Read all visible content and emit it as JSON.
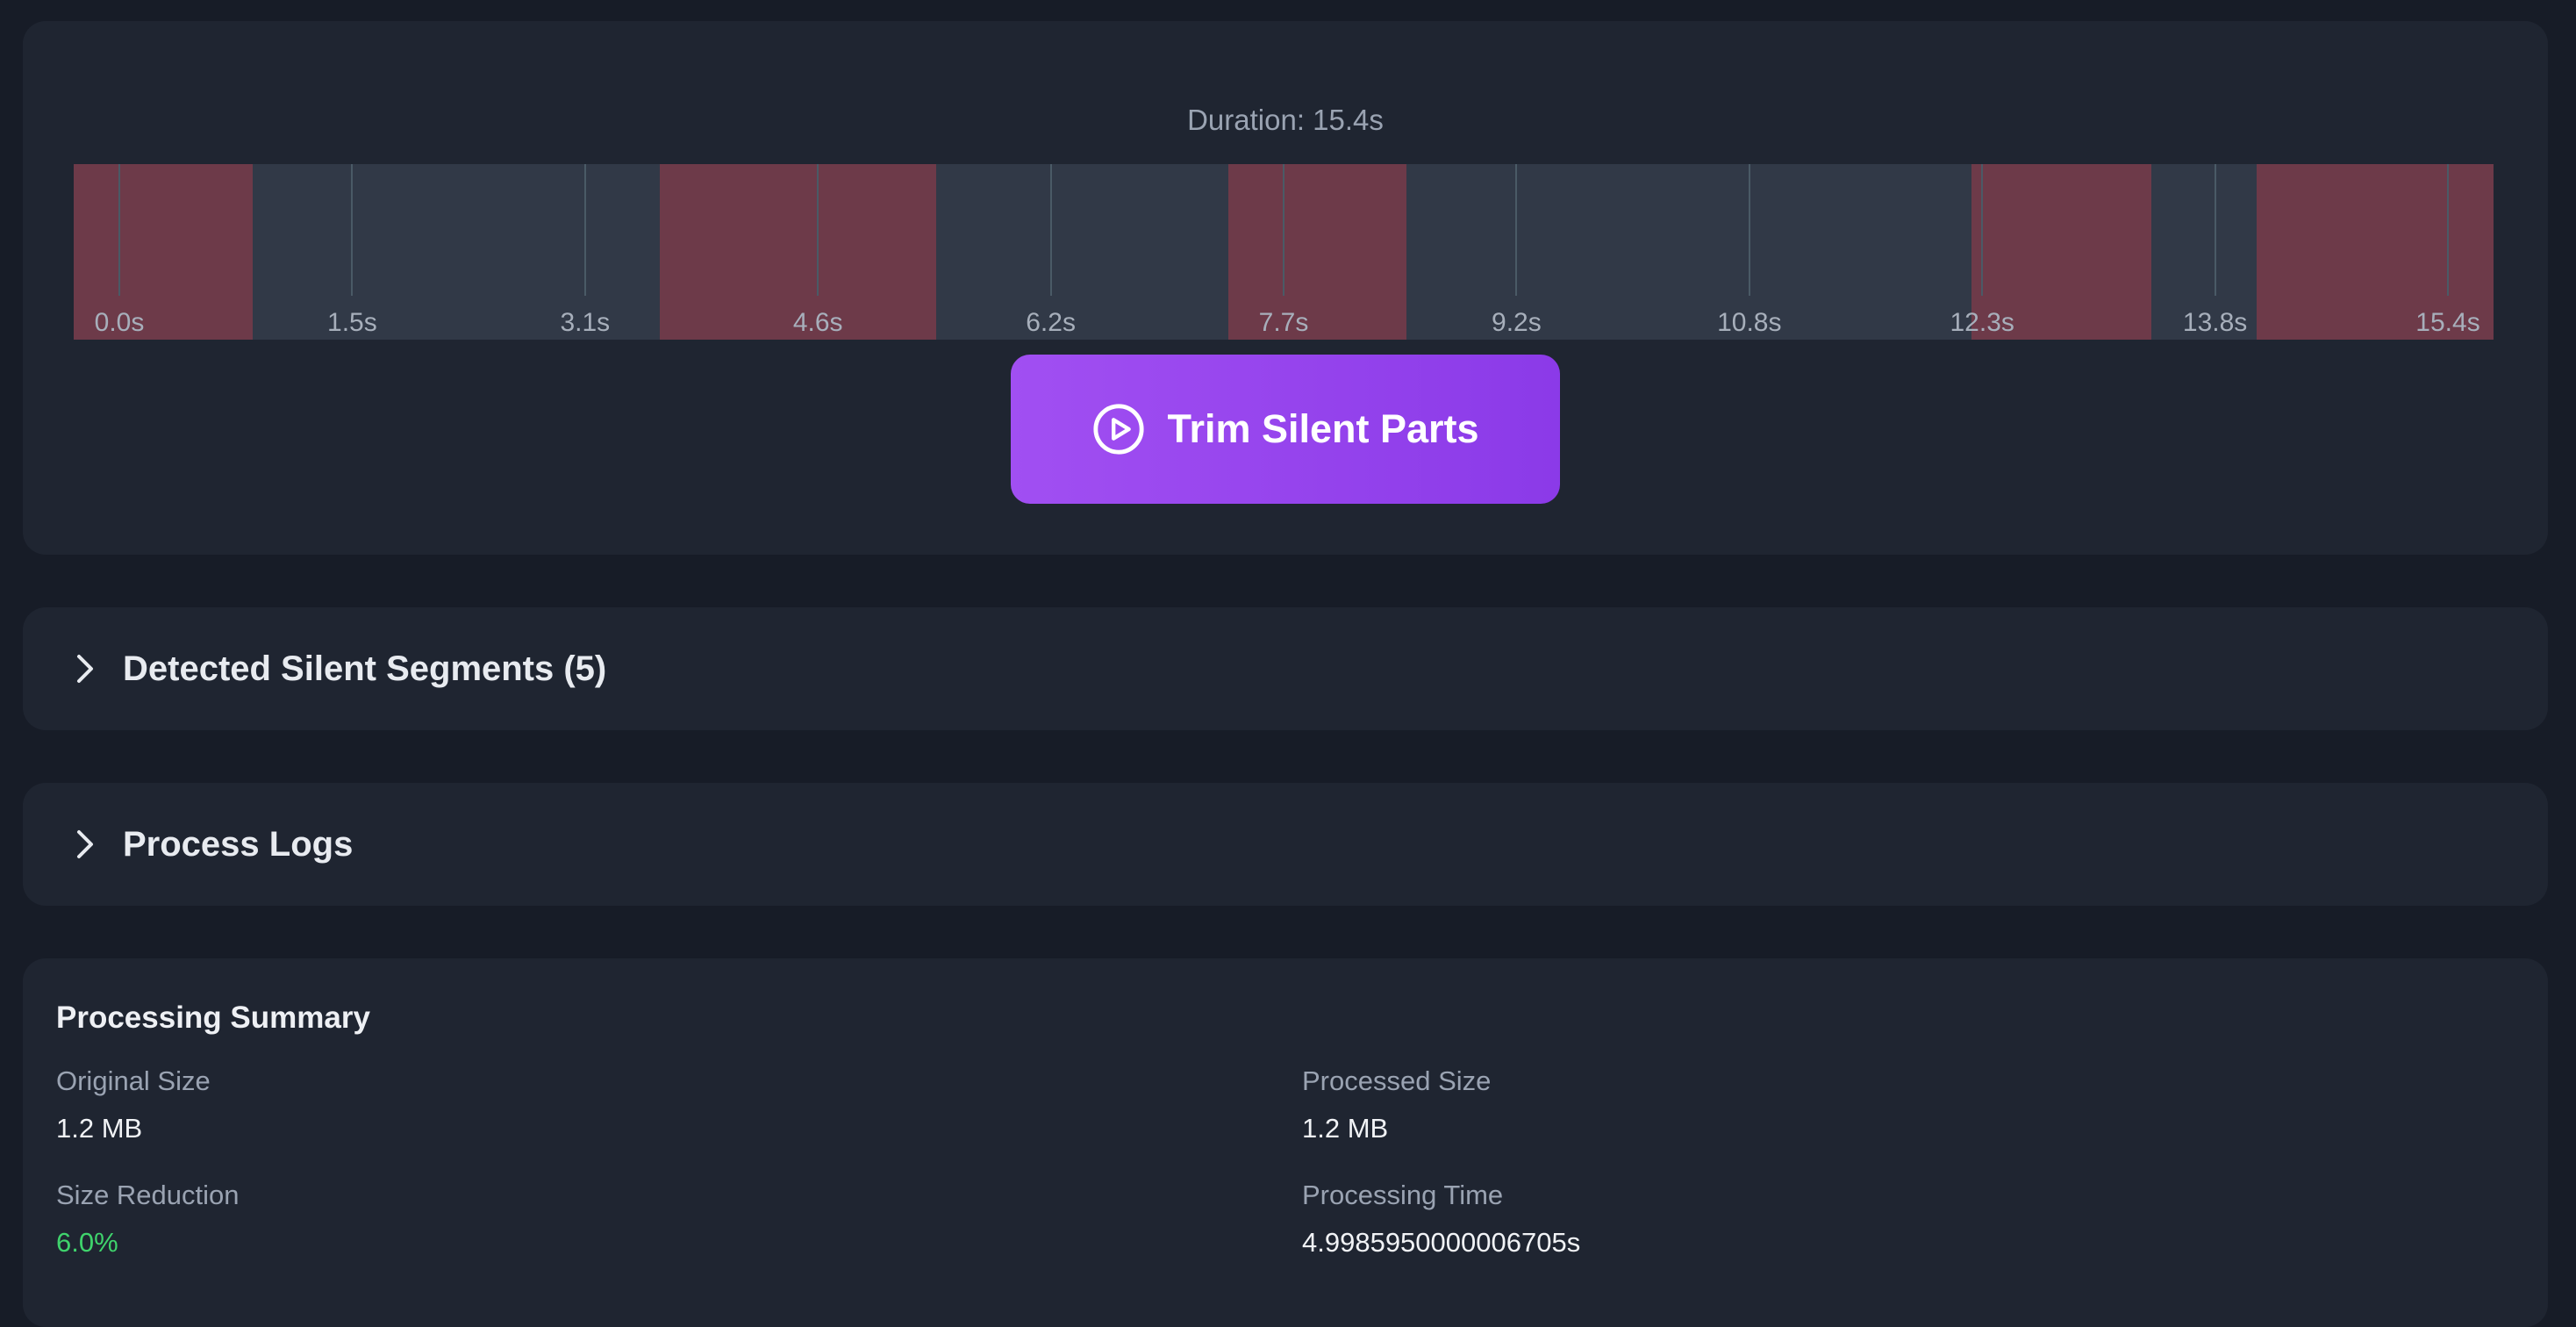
{
  "timeline": {
    "duration_label": "Duration: 15.4s",
    "duration_seconds": 15.4,
    "colors": {
      "track": "#313947",
      "silent": "#6d3a49",
      "tick": "#4a5a66"
    },
    "ticks": [
      "0.0s",
      "1.5s",
      "3.1s",
      "4.6s",
      "6.2s",
      "7.7s",
      "9.2s",
      "10.8s",
      "12.3s",
      "13.8s",
      "15.4s"
    ],
    "silent_segments": [
      {
        "start": 0.0,
        "end": 1.14
      },
      {
        "start": 3.73,
        "end": 5.49
      },
      {
        "start": 7.35,
        "end": 8.48
      },
      {
        "start": 12.08,
        "end": 13.22
      },
      {
        "start": 13.89,
        "end": 15.4
      }
    ]
  },
  "trim_button": {
    "label": "Trim Silent Parts",
    "icon": "play-circle-icon",
    "color": "#9a47f0"
  },
  "sections": {
    "segments": {
      "title": "Detected Silent Segments (5)",
      "icon": "chevron-right-icon"
    },
    "logs": {
      "title": "Process Logs",
      "icon": "chevron-right-icon"
    }
  },
  "summary": {
    "title": "Processing Summary",
    "original_size": {
      "label": "Original Size",
      "value": "1.2 MB"
    },
    "processed_size": {
      "label": "Processed Size",
      "value": "1.2 MB"
    },
    "size_reduction": {
      "label": "Size Reduction",
      "value": "6.0%",
      "color": "#3fd36c"
    },
    "processing_time": {
      "label": "Processing Time",
      "value": "4.9985950000006705s"
    }
  }
}
